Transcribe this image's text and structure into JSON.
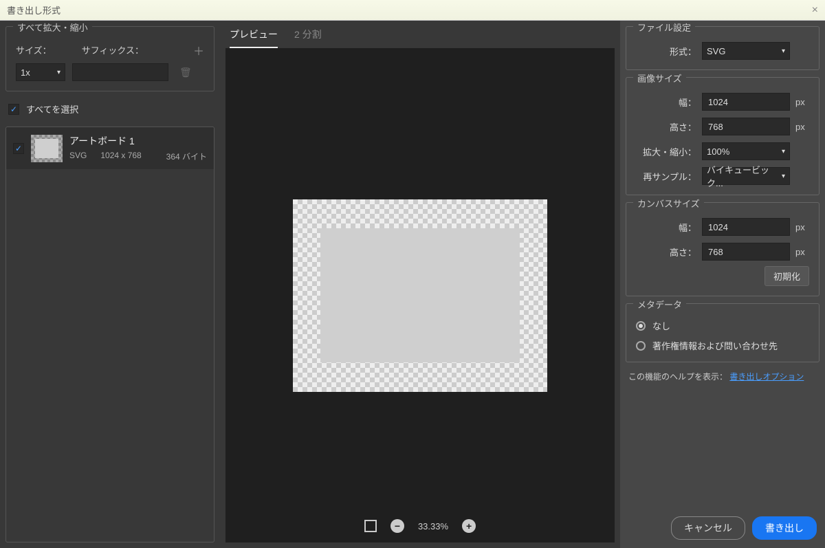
{
  "dialog": {
    "title": "書き出し形式"
  },
  "left": {
    "scaleSection": {
      "title": "すべて拡大・縮小",
      "sizeLabel": "サイズ：",
      "suffixLabel": "サフィックス：",
      "sizeValue": "1x",
      "suffixValue": ""
    },
    "selectAll": {
      "label": "すべてを選択",
      "checked": "✓"
    },
    "assets": [
      {
        "checked": "✓",
        "name": "アートボード 1",
        "format": "SVG",
        "dimensions": "1024 x 768",
        "filesize": "364 バイト"
      }
    ]
  },
  "center": {
    "tabs": {
      "preview": "プレビュー",
      "split": "2 分割"
    },
    "zoom": {
      "value": "33.33%"
    }
  },
  "right": {
    "fileSection": {
      "title": "ファイル設定",
      "formatLabel": "形式：",
      "formatValue": "SVG"
    },
    "imageSize": {
      "title": "画像サイズ",
      "widthLabel": "幅：",
      "widthValue": "1024",
      "heightLabel": "高さ：",
      "heightValue": "768",
      "scaleLabel": "拡大・縮小：",
      "scaleValue": "100%",
      "resampleLabel": "再サンプル：",
      "resampleValue": "バイキュービック...",
      "unit": "px"
    },
    "canvasSize": {
      "title": "カンバスサイズ",
      "widthLabel": "幅：",
      "widthValue": "1024",
      "heightLabel": "高さ：",
      "heightValue": "768",
      "unit": "px",
      "reset": "初期化"
    },
    "metadata": {
      "title": "メタデータ",
      "none": "なし",
      "copyright": "著作権情報および問い合わせ先"
    },
    "help": {
      "prefix": "この機能のヘルプを表示：",
      "link": "書き出しオプション"
    },
    "buttons": {
      "cancel": "キャンセル",
      "export": "書き出し"
    }
  }
}
